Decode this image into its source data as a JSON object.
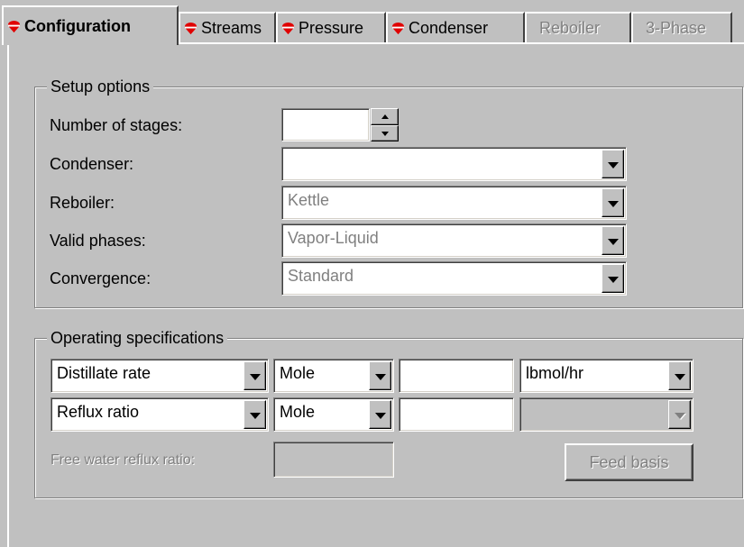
{
  "tabs": [
    {
      "label": "Configuration",
      "active": true,
      "enabled": true,
      "marker_color": "#e00000"
    },
    {
      "label": "Streams",
      "active": false,
      "enabled": true,
      "marker_color": "#e00000"
    },
    {
      "label": "Pressure",
      "active": false,
      "enabled": true,
      "marker_color": "#e00000"
    },
    {
      "label": "Condenser",
      "active": false,
      "enabled": true,
      "marker_color": "#e00000"
    },
    {
      "label": "Reboiler",
      "active": false,
      "enabled": false
    },
    {
      "label": "3-Phase",
      "active": false,
      "enabled": false
    }
  ],
  "setup": {
    "title": "Setup options",
    "stages_label": "Number of stages:",
    "stages_value": "",
    "condenser_label": "Condenser:",
    "condenser_value": "",
    "reboiler_label": "Reboiler:",
    "reboiler_value": "Kettle",
    "phases_label": "Valid phases:",
    "phases_value": "Vapor-Liquid",
    "convergence_label": "Convergence:",
    "convergence_value": "Standard"
  },
  "operating": {
    "title": "Operating specifications",
    "rows": [
      {
        "spec": "Distillate rate",
        "basis": "Mole",
        "value": "",
        "units": "lbmol/hr"
      },
      {
        "spec": "Reflux ratio",
        "basis": "Mole",
        "value": "",
        "units": ""
      }
    ],
    "free_water_label": "Free water reflux ratio:",
    "free_water_value": "",
    "feed_basis_label": "Feed basis"
  }
}
